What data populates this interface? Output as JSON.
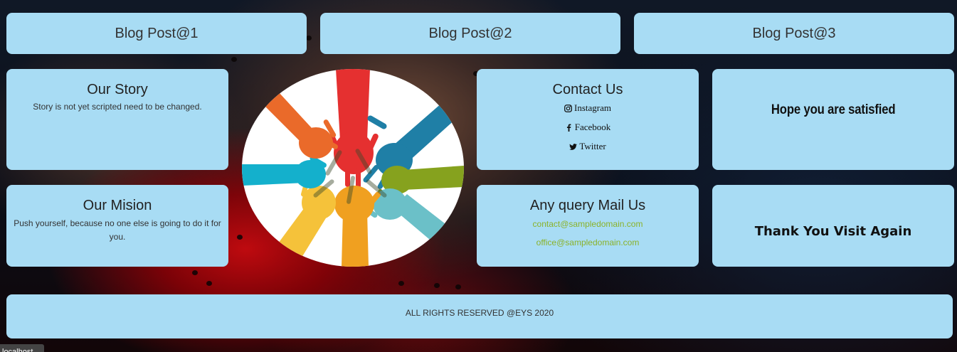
{
  "blog_posts": [
    "Blog Post@1",
    "Blog Post@2",
    "Blog Post@3"
  ],
  "story": {
    "title": "Our Story",
    "text": "Story is not yet scripted need to be changed."
  },
  "mision": {
    "title": "Our Mision",
    "text": "Push yourself, because no one else is going to do it for you."
  },
  "contact": {
    "title": "Contact Us",
    "links": [
      {
        "label": "Instagram",
        "icon": "instagram-icon"
      },
      {
        "label": "Facebook",
        "icon": "facebook-icon"
      },
      {
        "label": "Twitter",
        "icon": "twitter-icon"
      }
    ]
  },
  "mail": {
    "title": "Any query Mail Us",
    "emails": [
      "contact@sampledomain.com",
      "office@sampledomain.com"
    ]
  },
  "satisfied_text": "Hope you are satisfied",
  "thankyou_text": "Thank You Visit Again",
  "footer_text": "ALL RIGHTS RESERVED @EYS 2020",
  "status_tooltip": "localhost",
  "colors": {
    "card": "#a8dcf4",
    "email_link": "#8bb22a",
    "text": "#333333"
  },
  "logo": {
    "icon": "hands-circle-logo",
    "hand_colors": [
      "#e53030",
      "#1f7fa6",
      "#86a21e",
      "#6bc0c8",
      "#f0a020",
      "#f5c23a",
      "#14b0cc",
      "#ea6a2a"
    ]
  }
}
